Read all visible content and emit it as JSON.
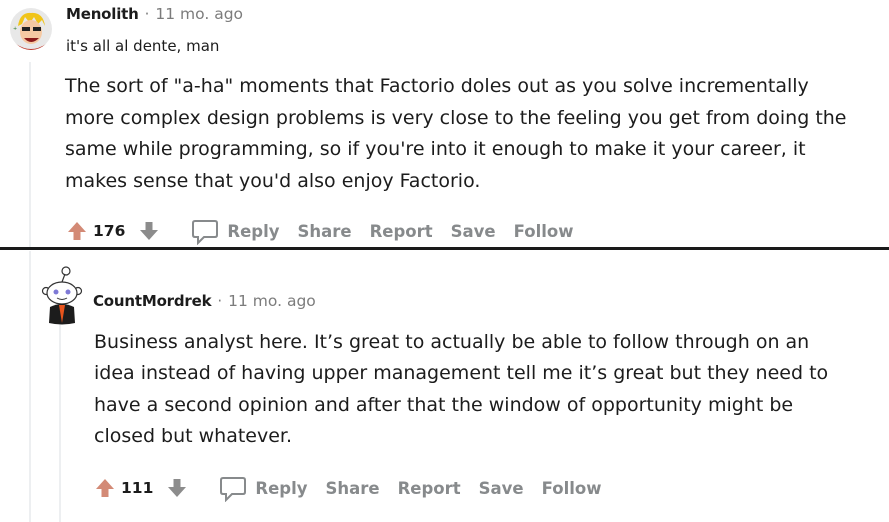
{
  "comments": [
    {
      "username": "Menolith",
      "separator": "·",
      "time": "11 mo. ago",
      "flair": "it's all al dente, man",
      "body_lines": [
        "The sort of \"a-ha\" moments that Factorio doles out as you solve incrementally",
        "more complex design problems is very close to the feeling you get from doing the",
        "same while programming, so if you're into it enough to make it your career, it",
        "makes sense that you'd also enjoy Factorio."
      ],
      "score": "176",
      "actions": {
        "reply": "Reply",
        "share": "Share",
        "report": "Report",
        "save": "Save",
        "follow": "Follow"
      }
    },
    {
      "username": "CountMordrek",
      "separator": "·",
      "time": "11 mo. ago",
      "body_lines": [
        "Business analyst here. It’s great to actually be able to follow through on an",
        "idea instead of having upper management tell me it’s great but they need to",
        "have a second opinion and after that the window of opportunity might be",
        "closed but whatever."
      ],
      "score": "111",
      "actions": {
        "reply": "Reply",
        "share": "Share",
        "report": "Report",
        "save": "Save",
        "follow": "Follow"
      }
    }
  ],
  "colors": {
    "upvote": "#cf8a7a",
    "downvote": "#8c8c8c",
    "meta_gray": "#7c7c7c",
    "action_gray": "#878a8c",
    "thread_line": "#edeff1",
    "divider": "#1a1a1a"
  }
}
